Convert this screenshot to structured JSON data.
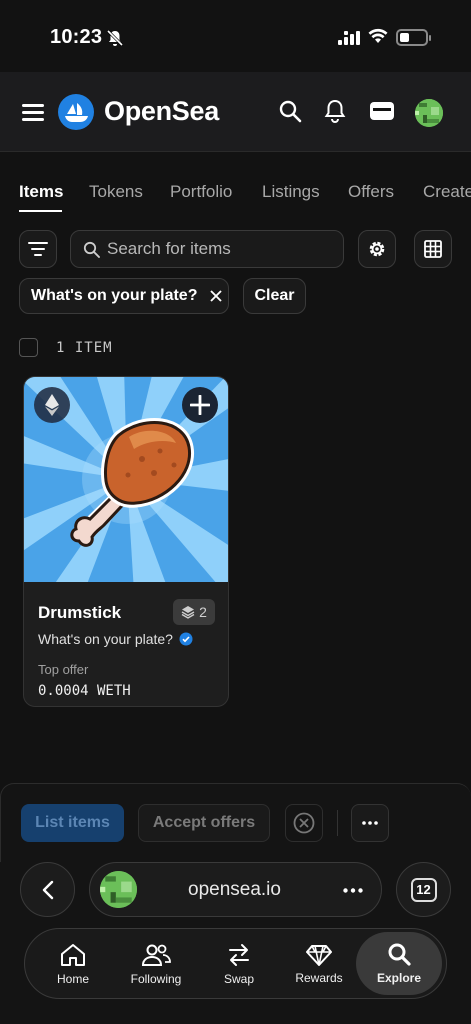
{
  "status_bar": {
    "time": "10:23"
  },
  "header": {
    "brand": "OpenSea"
  },
  "tabs": [
    {
      "label": "Items",
      "active": true
    },
    {
      "label": "Tokens"
    },
    {
      "label": "Portfolio"
    },
    {
      "label": "Listings"
    },
    {
      "label": "Offers"
    },
    {
      "label": "Create"
    }
  ],
  "search": {
    "placeholder": "Search for items"
  },
  "filters": {
    "active_filter": "What's on your plate?",
    "clear_label": "Clear"
  },
  "results": {
    "count_label": "1 ITEM"
  },
  "items": [
    {
      "title": "Drumstick",
      "quantity": "2",
      "collection": "What's on your plate?",
      "offer_label": "Top offer",
      "offer_value": "0.0004 WETH"
    }
  ],
  "actions": {
    "list_label": "List items",
    "accept_label": "Accept offers"
  },
  "browser": {
    "url": "opensea.io",
    "tab_count": "12"
  },
  "nav": [
    {
      "label": "Home",
      "icon": "home-icon"
    },
    {
      "label": "Following",
      "icon": "users-icon"
    },
    {
      "label": "Swap",
      "icon": "swap-icon"
    },
    {
      "label": "Rewards",
      "icon": "diamond-icon"
    },
    {
      "label": "Explore",
      "icon": "search-icon",
      "active": true
    }
  ],
  "colors": {
    "accent": "#2081e2",
    "background": "#121212",
    "card_sky": "#4aa3e8"
  }
}
